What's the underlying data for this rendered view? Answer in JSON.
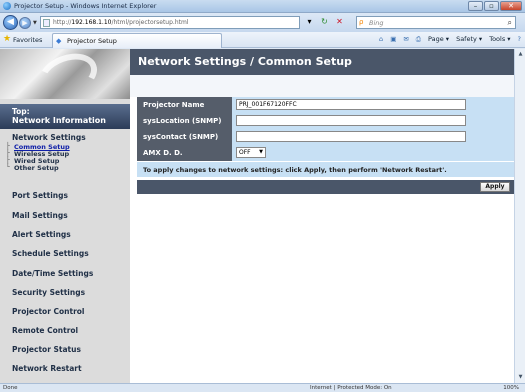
{
  "window": {
    "title": "Projector Setup - Windows Internet Explorer"
  },
  "address": {
    "url_prefix": "http://",
    "url_host": "192.168.1.10",
    "url_path": "/html/projectorsetup.html",
    "search_placeholder": "Bing"
  },
  "favorites": {
    "label": "Favorites",
    "tab_label": "Projector Setup"
  },
  "commandbar": {
    "page": "Page ▾",
    "safety": "Safety ▾",
    "tools": "Tools ▾"
  },
  "sidebar": {
    "top_line1": "Top:",
    "top_line2": "Network Information",
    "group": "Network Settings",
    "sub_items": [
      "Common Setup",
      "Wireless Setup",
      "Wired Setup",
      "Other Setup"
    ],
    "items": [
      "Port Settings",
      "Mail Settings",
      "Alert Settings",
      "Schedule Settings",
      "Date/Time Settings",
      "Security Settings",
      "Projector Control",
      "Remote Control",
      "Projector Status",
      "Network Restart"
    ]
  },
  "content": {
    "heading": "Network Settings / Common Setup",
    "fields": [
      {
        "label": "Projector Name",
        "value": "PRJ_001F67120FFC"
      },
      {
        "label": "sysLocation (SNMP)",
        "value": ""
      },
      {
        "label": "sysContact (SNMP)",
        "value": ""
      },
      {
        "label": "AMX D. D.",
        "value": "OFF"
      }
    ],
    "notice": "To apply changes to network settings: click Apply, then perform 'Network Restart'.",
    "apply_label": "Apply"
  },
  "status": {
    "left": "Done",
    "zone": "Internet | Protected Mode: On",
    "zoom": "100%"
  }
}
